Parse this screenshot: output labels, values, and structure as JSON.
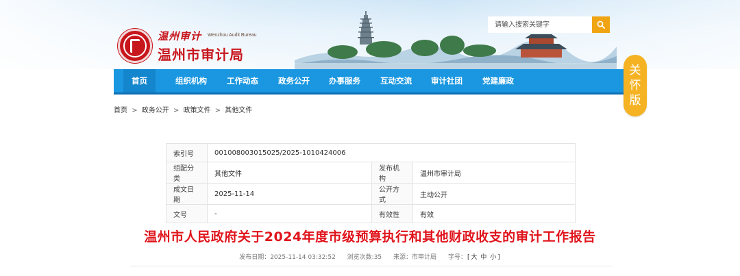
{
  "header": {
    "logo_script": "温州审计",
    "logo_en": "Wenzhou Audit Bureau",
    "logo_name": "温州市审计局",
    "search_placeholder": "请输入搜索关键字"
  },
  "nav": {
    "items": [
      "首页",
      "组织机构",
      "工作动态",
      "政务公开",
      "办事服务",
      "互动交流",
      "审计社团",
      "党建廉政"
    ],
    "active_index": 0
  },
  "care_badge": [
    "关",
    "怀",
    "版"
  ],
  "breadcrumb": {
    "items": [
      "首页",
      "政务公开",
      "政策文件",
      "其他文件"
    ],
    "separator": ">"
  },
  "meta": {
    "index_label": "索引号",
    "index_value": "001008003015025/2025-1010424006",
    "category_label": "组配分类",
    "category_value": "其他文件",
    "publisher_label": "发布机构",
    "publisher_value": "温州市审计局",
    "date_label": "成文日期",
    "date_value": "2025-11-14",
    "open_mode_label": "公开方式",
    "open_mode_value": "主动公开",
    "docno_label": "文号",
    "docno_value": "-",
    "validity_label": "有效性",
    "validity_value": "有效"
  },
  "document": {
    "title": "温州市人民政府关于2024年度市级预算执行和其他财政收支的审计工作报告",
    "publish_date": "发布日期：2025-11-14 03:32:52",
    "views": "浏览次数:35",
    "source": "来源：市审计局",
    "font_size_label": "字号：",
    "font_size_open": "[",
    "font_large": "大",
    "font_medium": "中",
    "font_small": "小",
    "font_size_close": "]"
  },
  "colors": {
    "nav_bg": "#1a97e0",
    "title_red": "#e0141c",
    "logo_red": "#c8161d",
    "accent_orange": "#f0a412",
    "care_badge": "#f5b324"
  }
}
